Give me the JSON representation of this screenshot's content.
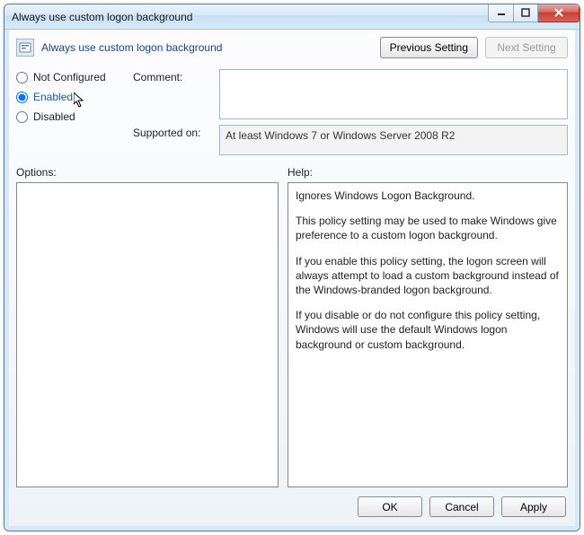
{
  "window": {
    "title": "Always use custom logon background"
  },
  "header": {
    "policy_title": "Always use custom logon background",
    "previous_label": "Previous Setting",
    "next_label": "Next Setting"
  },
  "state": {
    "options": [
      {
        "value": "not_configured",
        "label": "Not Configured"
      },
      {
        "value": "enabled",
        "label": "Enabled"
      },
      {
        "value": "disabled",
        "label": "Disabled"
      }
    ],
    "selected": "enabled"
  },
  "fields": {
    "comment_label": "Comment:",
    "comment_value": "",
    "supported_label": "Supported on:",
    "supported_value": "At least Windows 7 or Windows Server 2008 R2"
  },
  "panels": {
    "options_label": "Options:",
    "help_label": "Help:",
    "options_content": "",
    "help_paragraphs": [
      "Ignores Windows Logon Background.",
      "This policy setting may be used to make Windows give preference to a custom logon background.",
      "If you enable this policy setting, the logon screen will always attempt to load a custom background instead of the Windows-branded logon background.",
      "If you disable or do not configure this policy setting, Windows will use the default Windows logon background or custom background."
    ]
  },
  "footer": {
    "ok": "OK",
    "cancel": "Cancel",
    "apply": "Apply"
  }
}
